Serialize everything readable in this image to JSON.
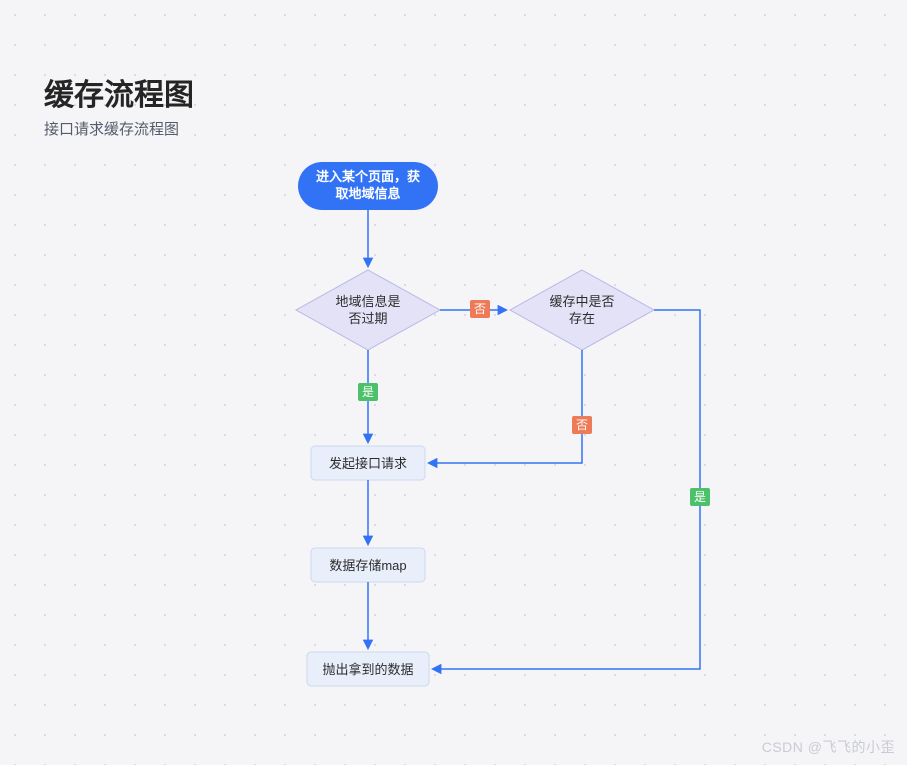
{
  "title": "缓存流程图",
  "subtitle": "接口请求缓存流程图",
  "watermark": "CSDN @飞飞的小歪",
  "nodes": {
    "start_line1": "进入某个页面，获",
    "start_line2": "取地域信息",
    "decision1_line1": "地域信息是",
    "decision1_line2": "否过期",
    "decision2_line1": "缓存中是否",
    "decision2_line2": "存在",
    "process1": "发起接口请求",
    "process2": "数据存储map",
    "process3": "抛出拿到的数据"
  },
  "labels": {
    "yes": "是",
    "no": "否"
  },
  "colors": {
    "primary": "#3273f6",
    "diamond_fill": "#e3e2f7",
    "box_fill": "#e8effb",
    "yes": "#4cc06a",
    "no": "#ed7b57"
  }
}
